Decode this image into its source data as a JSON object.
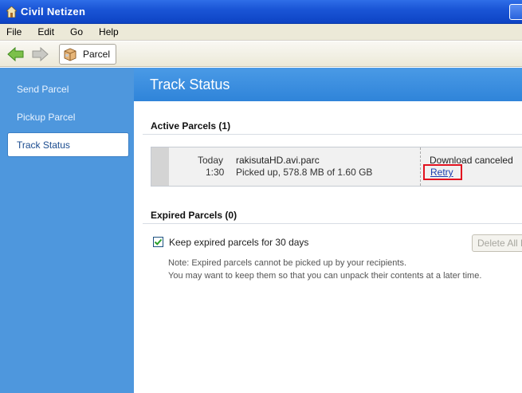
{
  "window": {
    "title": "Civil Netizen",
    "icon": "house-icon"
  },
  "menu": {
    "items": [
      "File",
      "Edit",
      "Go",
      "Help"
    ]
  },
  "toolbar": {
    "back_icon": "arrow-left-icon",
    "forward_icon": "arrow-right-icon",
    "breadcrumb_label": "Parcel",
    "breadcrumb_icon": "parcel-box-icon"
  },
  "sidebar": {
    "items": [
      {
        "label": "Send Parcel",
        "active": false
      },
      {
        "label": "Pickup Parcel",
        "active": false
      },
      {
        "label": "Track Status",
        "active": true
      }
    ]
  },
  "main": {
    "header": "Track Status",
    "active_section": {
      "title": "Active Parcels",
      "count": "(1)",
      "parcels": [
        {
          "day": "Today",
          "time": "1:30",
          "filename": "rakisutaHD.avi.parc",
          "progress_text": "Picked up, 578.8 MB of 1.60 GB",
          "status": "Download canceled",
          "action": "Retry"
        }
      ]
    },
    "expired_section": {
      "title": "Expired Parcels",
      "count": "(0)",
      "keep_label": "Keep expired parcels for 30 days",
      "keep_checked": true,
      "delete_button": "Delete All E",
      "note_line1": "Note: Expired parcels cannot be picked up by your recipients.",
      "note_line2": "You may want to keep them so that you can unpack their contents at a later time."
    }
  },
  "colors": {
    "title_bar": "#1a55d6",
    "sidebar": "#4e97dd",
    "header": "#3a8ddf",
    "highlight_border": "#e2121f",
    "link": "#1a3fb0"
  }
}
